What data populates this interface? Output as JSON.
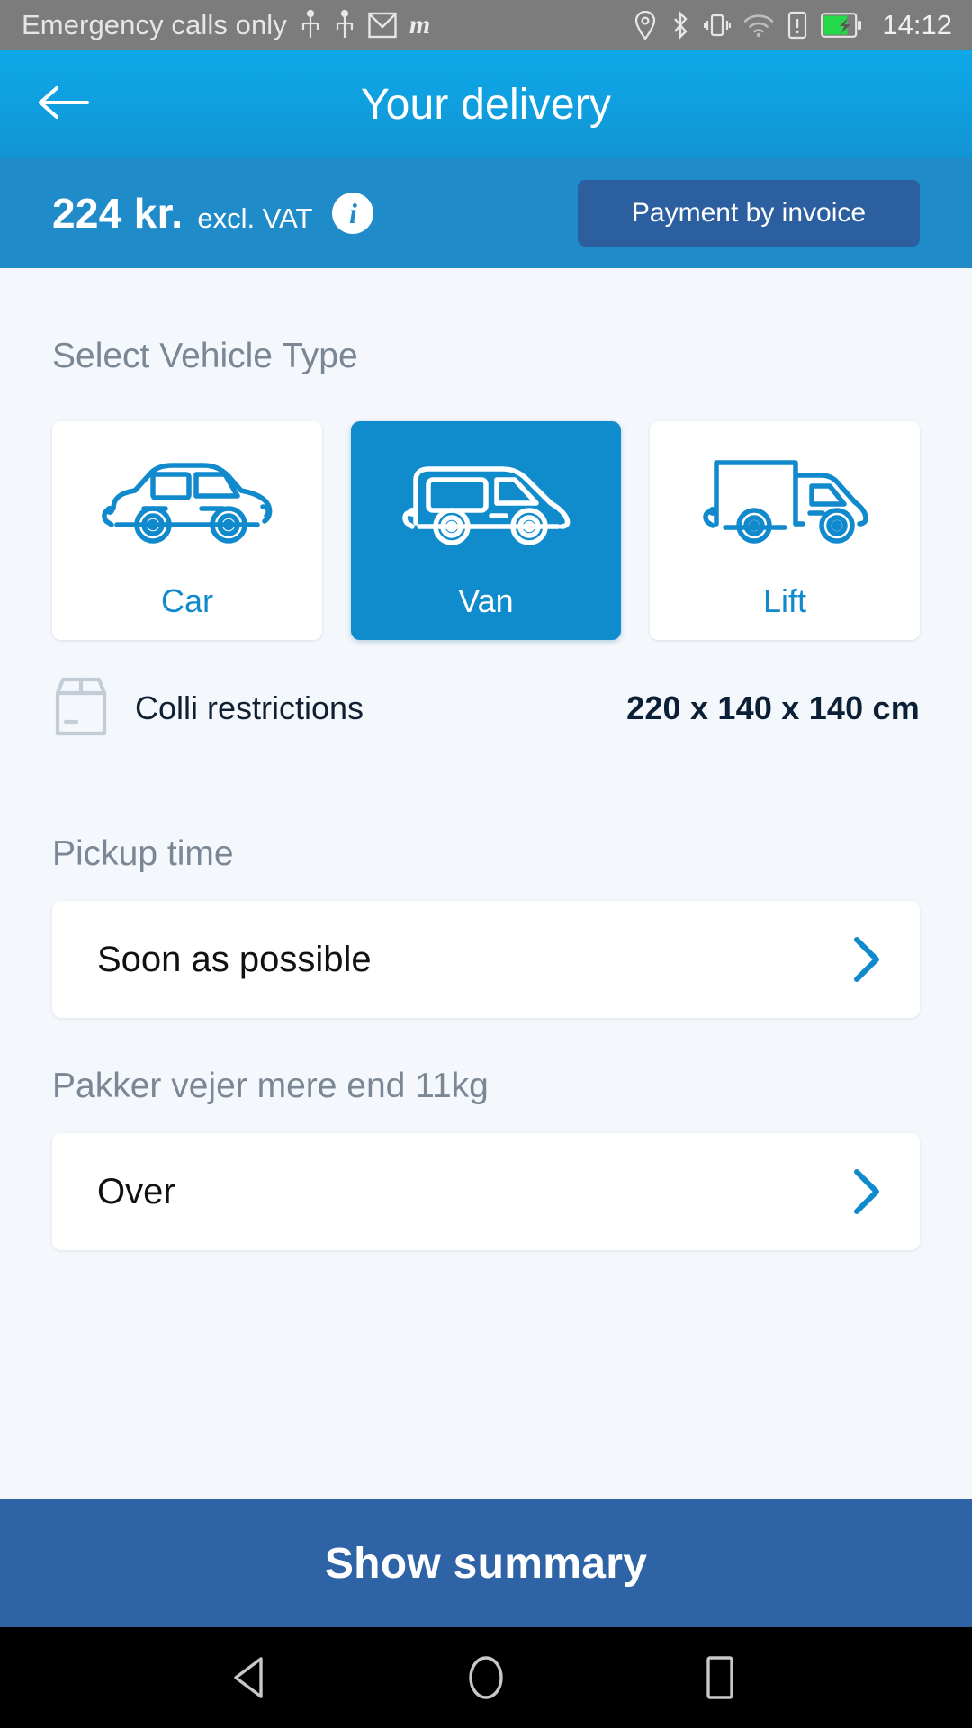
{
  "status_bar": {
    "carrier_text": "Emergency calls only",
    "left_icons": [
      "usb-icon",
      "usb-icon",
      "gmail-icon",
      "m-app-icon"
    ],
    "right_icons": [
      "location-icon",
      "bluetooth-icon",
      "vibrate-icon",
      "wifi-icon",
      "sim-alert-icon",
      "battery-charging-icon"
    ],
    "m_logo_text": "m",
    "time": "14:12"
  },
  "appbar": {
    "back_icon": "arrow-left-icon",
    "title": "Your delivery"
  },
  "price_bar": {
    "amount": "224 kr.",
    "vat_note": "excl. VAT",
    "info_icon_label": "i",
    "invoice_button": "Payment by invoice"
  },
  "vehicle_section": {
    "label": "Select Vehicle Type",
    "options": [
      {
        "label": "Car",
        "icon": "car-icon",
        "selected": false
      },
      {
        "label": "Van",
        "icon": "van-icon",
        "selected": true
      },
      {
        "label": "Lift",
        "icon": "lift-truck-icon",
        "selected": false
      }
    ]
  },
  "colli": {
    "icon": "box-icon",
    "label": "Colli restrictions",
    "value": "220 x 140 x 140 cm"
  },
  "pickup": {
    "label": "Pickup time",
    "value": "Soon as possible",
    "chevron_icon": "chevron-right-icon"
  },
  "weight": {
    "label": "Pakker vejer mere end 11kg",
    "value": "Over",
    "chevron_icon": "chevron-right-icon"
  },
  "cta": {
    "label": "Show summary"
  },
  "navbar": {
    "back_icon": "nav-back-triangle-icon",
    "home_icon": "nav-home-circle-icon",
    "recents_icon": "nav-recents-square-icon"
  },
  "colors": {
    "brand_blue": "#108ccd",
    "appbar_blue": "#0f9ede",
    "pricebar_blue": "#1f8cc9",
    "invoice_button_blue": "#2c5fa0",
    "cta_blue": "#2e63a5",
    "page_background": "#f4f7fb",
    "label_grey": "#7b8794",
    "value_navy": "#0b1f36"
  }
}
